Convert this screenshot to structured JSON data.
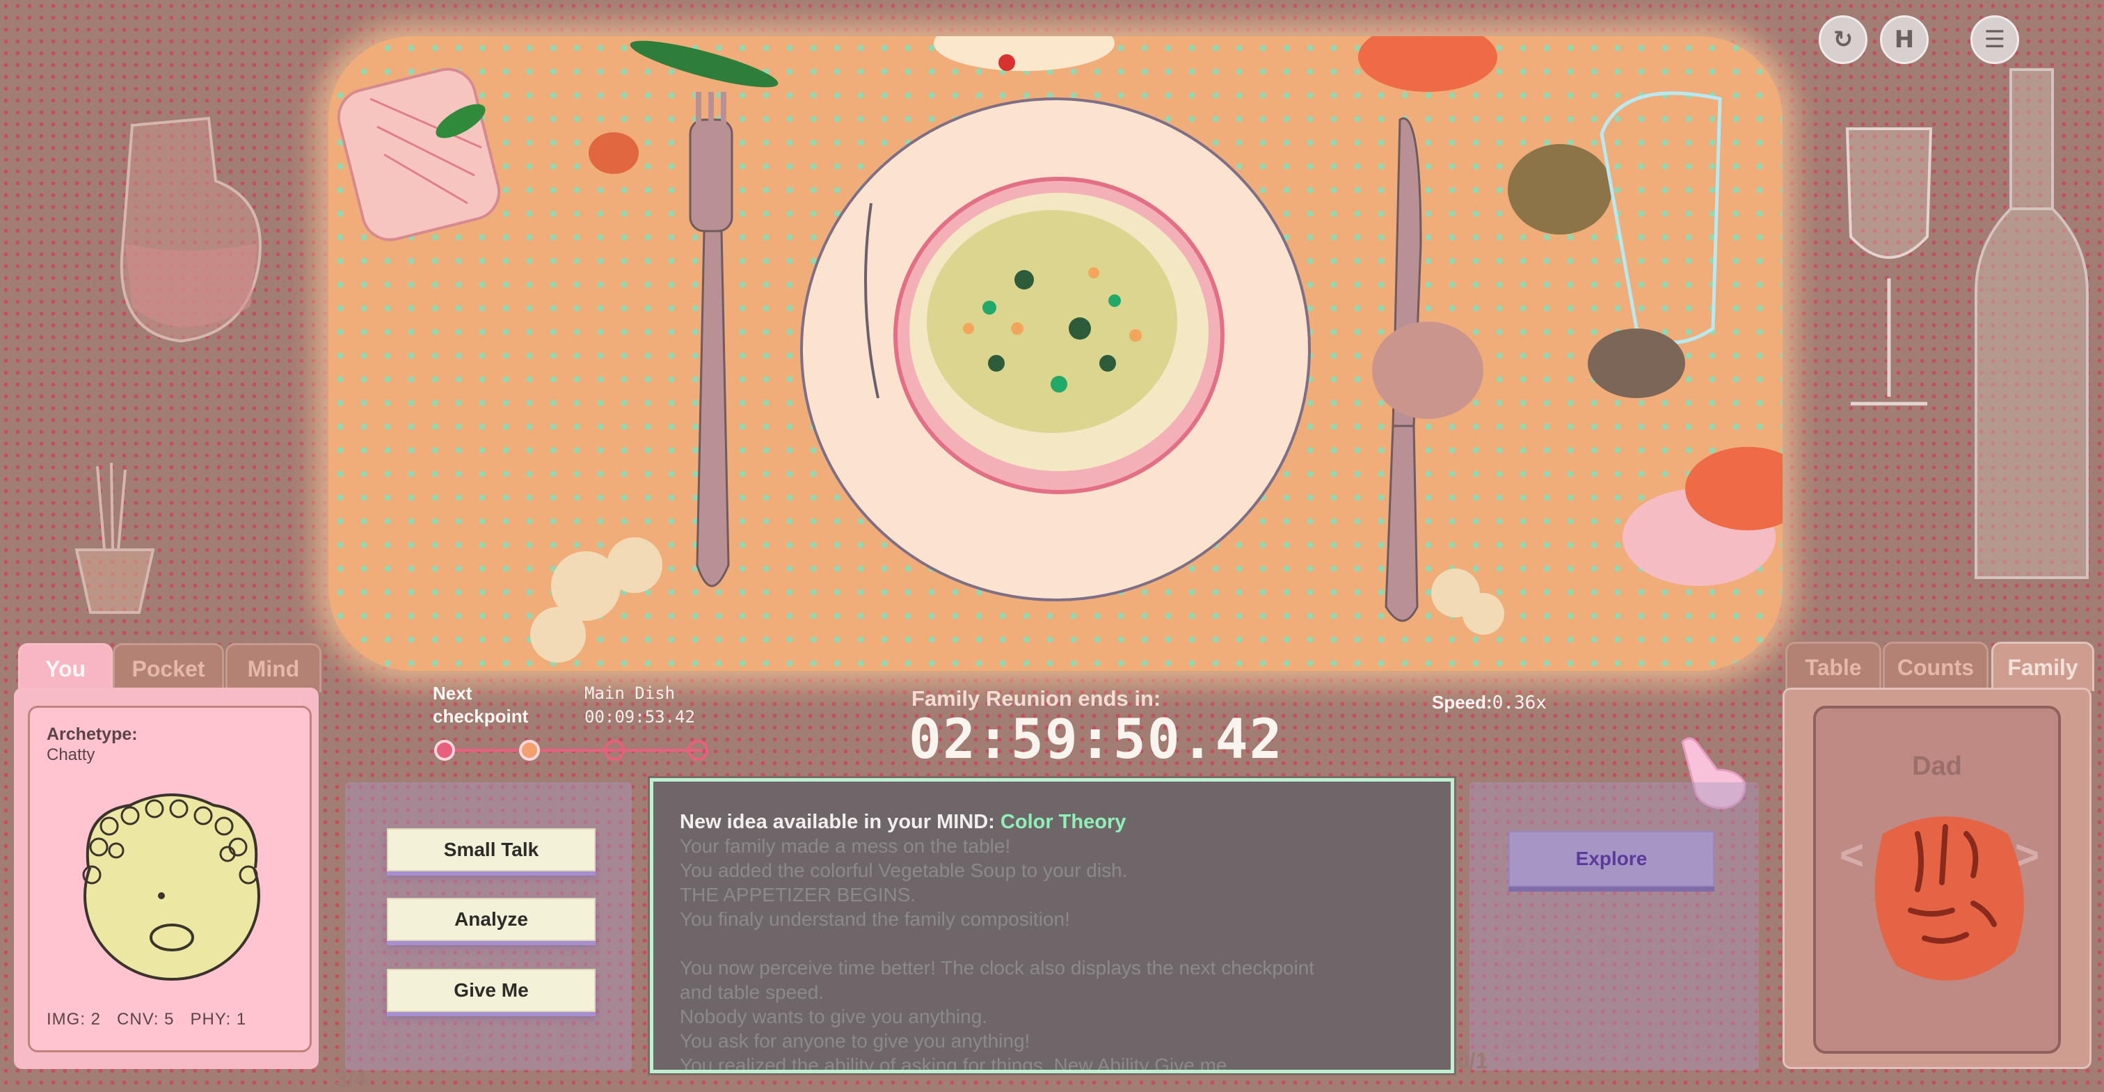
{
  "top_controls": {
    "restart_icon": "restart-icon",
    "hold_icon": "H",
    "menu_icon": "menu-icon"
  },
  "left_tabs": [
    "You",
    "Pocket",
    "Mind"
  ],
  "you_card": {
    "archetype_label": "Archetype:",
    "archetype_value": "Chatty",
    "stats": {
      "img_label": "IMG:",
      "img": "2",
      "cnv_label": "CNV:",
      "cnv": "5",
      "phy_label": "PHY:",
      "phy": "1"
    }
  },
  "checkpoint": {
    "label": "Next checkpoint",
    "name": "Main Dish",
    "time": "00:09:53.42"
  },
  "timer": {
    "label": "Family Reunion ends in:",
    "value": "02:59:50.42"
  },
  "speed": {
    "label": "Speed:",
    "value": "0.36x"
  },
  "actions": {
    "buttons": [
      "Small Talk",
      "Analyze",
      "Give Me"
    ],
    "counter": "3/4"
  },
  "log": {
    "title_prefix": "New idea available in your MIND:",
    "title_highlight": "Color Theory",
    "lines": [
      "Your family made a mess on the table!",
      "You added the colorful Vegetable Soup to your dish.",
      "THE APPETIZER BEGINS.",
      "You finaly understand the family composition!",
      "",
      "You now perceive time better! The clock also displays the next checkpoint",
      "and table speed.",
      "Nobody wants to give you anything.",
      "You ask for anyone to give you anything!",
      "You realized the ability of asking for things. New Ability Give me"
    ]
  },
  "explore": {
    "label": "Explore",
    "counter": "0/1"
  },
  "right_tabs": [
    "Table",
    "Counts",
    "Family"
  ],
  "family_card": {
    "name": "Dad",
    "prev": "<",
    "next": ">"
  },
  "colors": {
    "background": "#a27d73",
    "table": "#f0ad79",
    "accent_pink": "#f7bbc6",
    "idea_green": "#8ff0b8"
  }
}
